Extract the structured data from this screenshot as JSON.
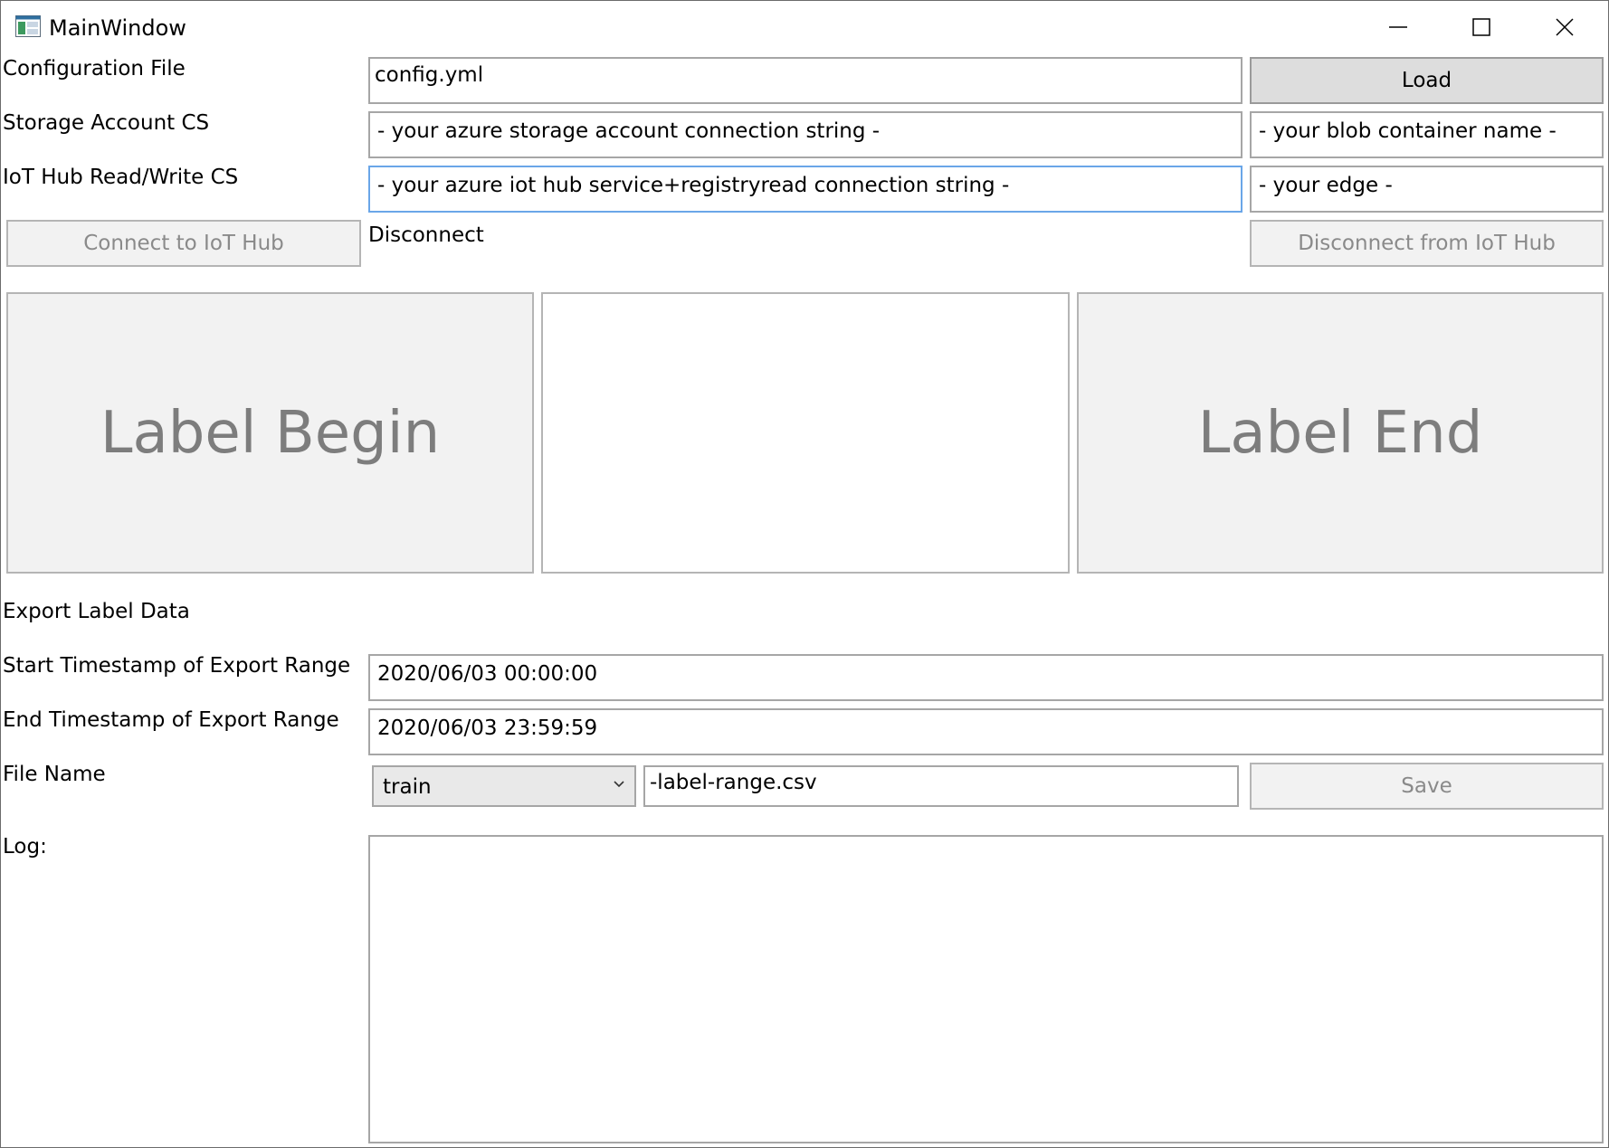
{
  "window": {
    "title": "MainWindow",
    "icon": "app-window-icon",
    "controls": [
      "minimize-icon",
      "maximize-icon",
      "close-icon"
    ]
  },
  "config": {
    "label": "Configuration File",
    "value": "config.yml",
    "load_button": "Load"
  },
  "storage": {
    "label": "Storage Account CS",
    "connection_string": "- your azure storage account connection string -",
    "container_name": "- your blob container name -"
  },
  "iothub": {
    "label": "IoT Hub Read/Write CS",
    "connection_string": "- your azure iot hub service+registryread connection string -",
    "edge": "- your edge -",
    "connect_button": "Connect to IoT Hub",
    "status": "Disconnect",
    "disconnect_button": "Disconnect from IoT Hub"
  },
  "labeling": {
    "begin_button": "Label Begin",
    "end_button": "Label End"
  },
  "export": {
    "heading": "Export Label Data",
    "start_label": "Start Timestamp of Export Range",
    "start_value": "2020/06/03 00:00:00",
    "end_label": "End Timestamp of Export Range",
    "end_value": "2020/06/03 23:59:59",
    "file_label": "File Name",
    "file_prefix": "train",
    "file_suffix": "-label-range.csv",
    "save_button": "Save"
  },
  "log": {
    "label": "Log:",
    "content": ""
  },
  "colors": {
    "focus_border": "#6aa6e8",
    "button_bg": "#f2f2f2",
    "active_button_bg": "#dddddd",
    "disabled_text": "#8a8a8a"
  }
}
